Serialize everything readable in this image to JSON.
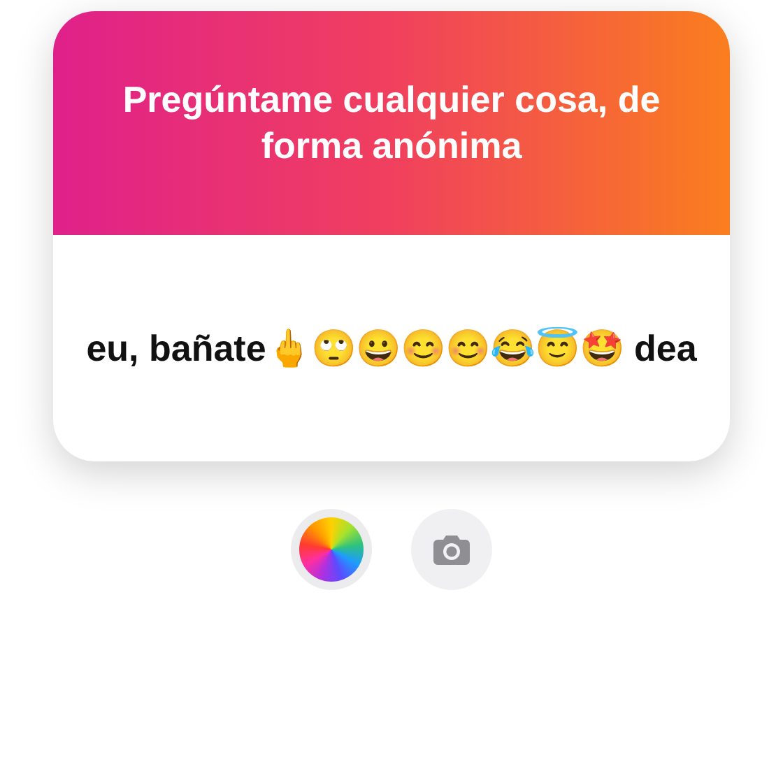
{
  "sticker": {
    "title": "Pregúntame cualquier cosa, de forma anónima",
    "answer": "eu, bañate🖕🙄😀😊😊😂😇🤩 dea"
  }
}
